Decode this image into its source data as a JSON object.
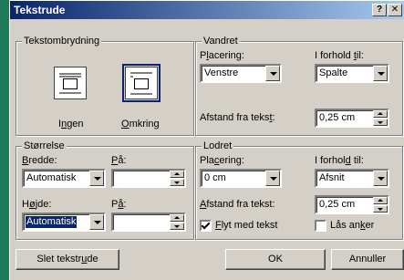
{
  "dialog": {
    "title": "Tekstrude",
    "help_button": "?",
    "close_button": "✕"
  },
  "wrapping": {
    "group_label": "Tekstombrydning",
    "none_label": "Ingen",
    "around_label": "Omkring",
    "selected": "around"
  },
  "size": {
    "group_label": "Størrelse",
    "width_label": "Bredde:",
    "width_value": "Automatisk",
    "width_at_label": "På:",
    "width_at_value": "",
    "height_label": "Højde:",
    "height_value": "Automatisk",
    "height_at_label": "På:",
    "height_at_value": ""
  },
  "horizontal": {
    "group_label": "Vandret",
    "position_label": "Placering:",
    "position_value": "Venstre",
    "relative_label": "I forhold til:",
    "relative_value": "Spalte",
    "distance_label": "Afstand fra tekst:",
    "distance_value": "0,25 cm"
  },
  "vertical": {
    "group_label": "Lodret",
    "position_label": "Placering:",
    "position_value": "0 cm",
    "relative_label": "I forhold til:",
    "relative_value": "Afsnit",
    "distance_label": "Afstand fra tekst:",
    "distance_value": "0,25 cm",
    "move_with_text_label": "Flyt med tekst",
    "move_with_text_checked": true,
    "lock_anchor_label": "Lås anker",
    "lock_anchor_checked": false
  },
  "buttons": {
    "remove_frame": "Slet tekstrude",
    "ok": "OK",
    "cancel": "Annuller"
  },
  "colors": {
    "titlebar_start": "#0a246a",
    "titlebar_end": "#a6caf0",
    "dialog_face": "#d4d0c8",
    "desktop": "#1e7a58"
  }
}
